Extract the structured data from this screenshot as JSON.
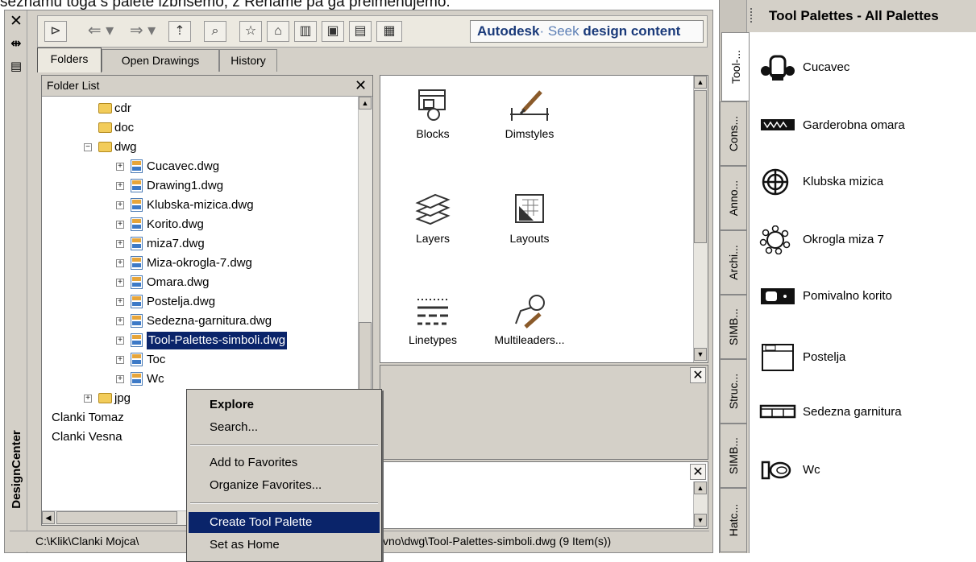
{
  "caption": "seznamu toga s palete izbrišemo, z Rename pa ga preimenujemo.",
  "designcenter": {
    "title": "DesignCenter",
    "toolbar": {
      "brand": "Autodesk",
      "seek": "Seek",
      "seek_tail": "design content"
    },
    "tabs": [
      {
        "label": "Folders",
        "active": true
      },
      {
        "label": "Open Drawings",
        "active": false
      },
      {
        "label": "History",
        "active": false
      }
    ],
    "folder_list": {
      "header": "Folder List",
      "items": [
        {
          "label": "cdr",
          "type": "folder",
          "level": 2
        },
        {
          "label": "doc",
          "type": "folder",
          "level": 2
        },
        {
          "label": "dwg",
          "type": "folder",
          "level": 2,
          "expanded": true
        },
        {
          "label": "Cucavec.dwg",
          "type": "file",
          "level": 3
        },
        {
          "label": "Drawing1.dwg",
          "type": "file",
          "level": 3
        },
        {
          "label": "Klubska-mizica.dwg",
          "type": "file",
          "level": 3
        },
        {
          "label": "Korito.dwg",
          "type": "file",
          "level": 3
        },
        {
          "label": "miza7.dwg",
          "type": "file",
          "level": 3
        },
        {
          "label": "Miza-okrogla-7.dwg",
          "type": "file",
          "level": 3
        },
        {
          "label": "Omara.dwg",
          "type": "file",
          "level": 3
        },
        {
          "label": "Postelja.dwg",
          "type": "file",
          "level": 3
        },
        {
          "label": "Sedezna-garnitura.dwg",
          "type": "file",
          "level": 3
        },
        {
          "label": "Tool-Palettes-simboli.dwg",
          "type": "file",
          "level": 3,
          "selected": true
        },
        {
          "label": "Toc",
          "type": "file",
          "level": 3
        },
        {
          "label": "Wc",
          "type": "file",
          "level": 3
        },
        {
          "label": "jpg",
          "type": "folder",
          "level": 2
        },
        {
          "label": "Clanki Tomaz",
          "type": "folder",
          "level": 0
        },
        {
          "label": "Clanki Vesna",
          "type": "folder",
          "level": 0
        }
      ]
    },
    "content_items": [
      {
        "label": "Blocks",
        "icon": "blocks-icon"
      },
      {
        "label": "Dimstyles",
        "icon": "dimstyles-icon"
      },
      {
        "label": "Layers",
        "icon": "layers-icon"
      },
      {
        "label": "Layouts",
        "icon": "layouts-icon"
      },
      {
        "label": "Linetypes",
        "icon": "linetypes-icon"
      },
      {
        "label": "Multileaders...",
        "icon": "multileaders-icon"
      }
    ],
    "status": {
      "left": "C:\\Klik\\Clanki Mojca\\",
      "right": "vno\\dwg\\Tool-Palettes-simboli.dwg (9 Item(s))"
    },
    "context_menu": [
      {
        "label": "Explore",
        "bold": true
      },
      {
        "label": "Search..."
      },
      {
        "separator": true
      },
      {
        "label": "Add to Favorites"
      },
      {
        "label": "Organize Favorites..."
      },
      {
        "separator": true
      },
      {
        "label": "Create Tool Palette",
        "highlighted": true
      },
      {
        "label": "Set as Home"
      }
    ]
  },
  "tool_palettes": {
    "title": "Tool Palettes - All Palettes",
    "tabs": [
      {
        "label": "Tool-...",
        "active": true
      },
      {
        "label": "Cons..."
      },
      {
        "label": "Anno..."
      },
      {
        "label": "Archi..."
      },
      {
        "label": "SIMB..."
      },
      {
        "label": "Struc..."
      },
      {
        "label": "SIMB..."
      },
      {
        "label": "Hatc..."
      }
    ],
    "tools": [
      {
        "label": "Cucavec",
        "icon": "cucavec-icon"
      },
      {
        "label": "Garderobna omara",
        "icon": "garderobna-omara-icon"
      },
      {
        "label": "Klubska mizica",
        "icon": "klubska-mizica-icon"
      },
      {
        "label": "Okrogla miza 7",
        "icon": "okrogla-miza-icon"
      },
      {
        "label": "Pomivalno korito",
        "icon": "pomivalno-korito-icon"
      },
      {
        "label": "Postelja",
        "icon": "postelja-icon"
      },
      {
        "label": "Sedezna garnitura",
        "icon": "sedezna-garnitura-icon"
      },
      {
        "label": "Wc",
        "icon": "wc-icon"
      }
    ]
  }
}
